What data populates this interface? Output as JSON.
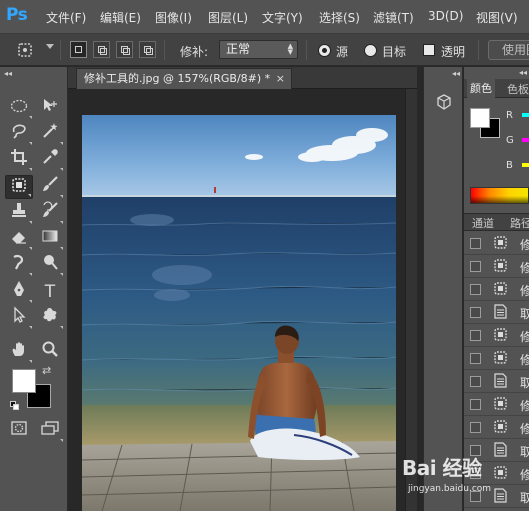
{
  "app": {
    "logo": "Ps"
  },
  "menu": [
    "文件(F)",
    "编辑(E)",
    "图像(I)",
    "图层(L)",
    "文字(Y)",
    "选择(S)",
    "滤镜(T)",
    "3D(D)",
    "视图(V)"
  ],
  "options": {
    "patch_label": "修补:",
    "patch_mode": "正常",
    "source_label": "源",
    "target_label": "目标",
    "transparent_label": "透明",
    "use_pattern_label": "使用图"
  },
  "document": {
    "tab_title": "修补工具的.jpg @ 157%(RGB/8#) *",
    "close_glyph": "×"
  },
  "toolbox": {
    "grip": "◂◂",
    "type_tool_glyph": "T"
  },
  "color_panel": {
    "tabs": [
      "颜色",
      "色板"
    ],
    "channels": [
      "R",
      "G",
      "B"
    ],
    "channel_colors": [
      "#00ffff",
      "#ff00ff",
      "#ffff00"
    ]
  },
  "layers_panel": {
    "tabs": [
      "通道",
      "路径"
    ],
    "rows": [
      {
        "icon": "patch-icon",
        "label": "修"
      },
      {
        "icon": "patch-icon",
        "label": "修"
      },
      {
        "icon": "patch-icon",
        "label": "修"
      },
      {
        "icon": "document-icon",
        "label": "取"
      },
      {
        "icon": "patch-icon",
        "label": "修"
      },
      {
        "icon": "patch-icon",
        "label": "修"
      },
      {
        "icon": "document-icon",
        "label": "取"
      },
      {
        "icon": "patch-icon",
        "label": "修"
      },
      {
        "icon": "patch-icon",
        "label": "修"
      },
      {
        "icon": "document-icon",
        "label": "取"
      },
      {
        "icon": "patch-icon",
        "label": "修"
      },
      {
        "icon": "document-icon",
        "label": "取"
      }
    ]
  },
  "watermark": {
    "brand": "Bai 经验",
    "url": "jingyan.baidu.com"
  }
}
